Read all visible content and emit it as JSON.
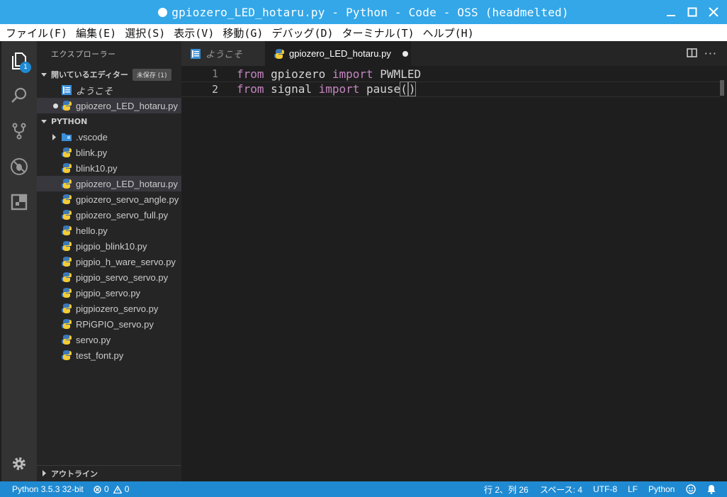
{
  "window": {
    "title": "gpiozero_LED_hotaru.py - Python - Code - OSS (headmelted)"
  },
  "menu": [
    "ファイル(F)",
    "編集(E)",
    "選択(S)",
    "表示(V)",
    "移動(G)",
    "デバッグ(D)",
    "ターミナル(T)",
    "ヘルプ(H)"
  ],
  "activity": {
    "explorer_badge": "1"
  },
  "sidebar": {
    "title": "エクスプローラー",
    "open_editors": {
      "header": "開いているエディター",
      "badge": "未保存 (1)",
      "items": [
        {
          "label": "ようこそ"
        },
        {
          "label": "gpiozero_LED_hotaru.py"
        }
      ]
    },
    "project": {
      "header": "PYTHON",
      "folder": ".vscode",
      "files": [
        "blink.py",
        "blink10.py",
        "gpiozero_LED_hotaru.py",
        "gpiozero_servo_angle.py",
        "gpiozero_servo_full.py",
        "hello.py",
        "pigpio_blink10.py",
        "pigpio_h_ware_servo.py",
        "pigpio_servo_servo.py",
        "pigpio_servo.py",
        "pigpiozero_servo.py",
        "RPiGPIO_servo.py",
        "servo.py",
        "test_font.py"
      ]
    },
    "outline": {
      "header": "アウトライン"
    }
  },
  "tabs": [
    {
      "label": "ようこそ"
    },
    {
      "label": "gpiozero_LED_hotaru.py"
    }
  ],
  "editor": {
    "lines": [
      {
        "num": "1",
        "kw1": "from",
        "mod": " gpiozero ",
        "kw2": "import",
        "name": " PWMLED"
      },
      {
        "num": "2",
        "kw1": "from",
        "mod": " signal ",
        "kw2": "import",
        "name": " pause",
        "open": "(",
        "close": ")"
      }
    ]
  },
  "status": {
    "interpreter": "Python 3.5.3 32-bit",
    "errors": "0",
    "warnings": "0",
    "position": "行 2、列 26",
    "spaces": "スペース: 4",
    "encoding": "UTF-8",
    "eol": "LF",
    "language": "Python"
  }
}
